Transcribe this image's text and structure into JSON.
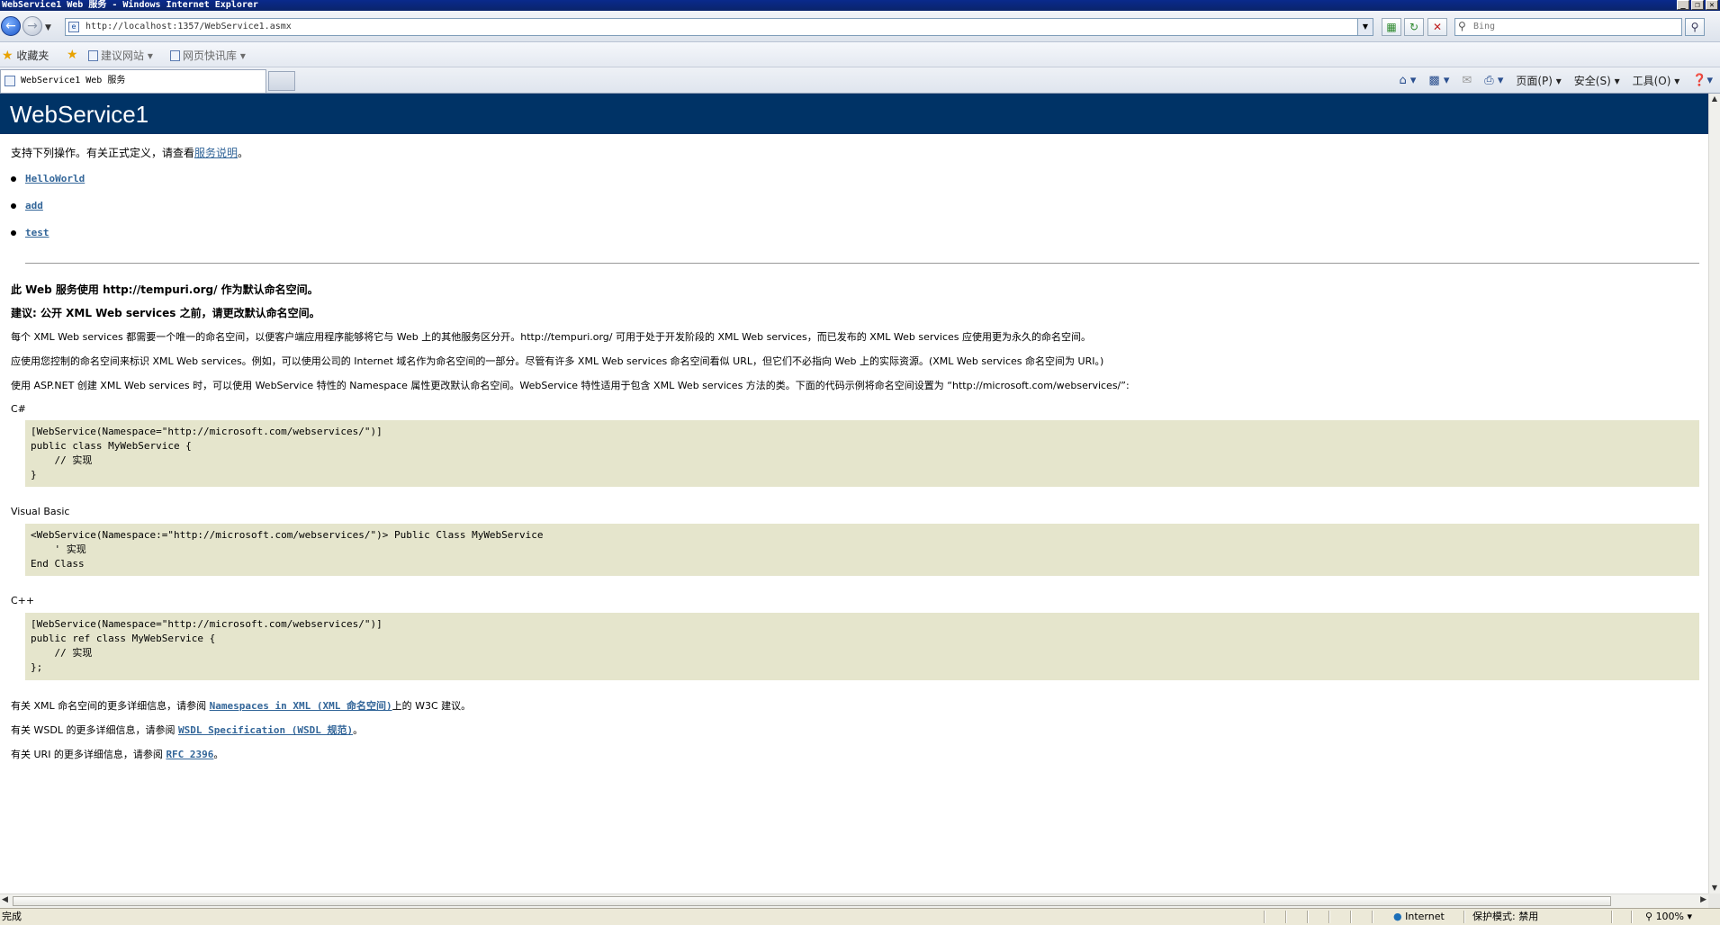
{
  "window": {
    "title": "WebService1 Web 服务 - Windows Internet Explorer",
    "controls": {
      "minimize": "_",
      "restore": "❐",
      "close": "✕"
    }
  },
  "address_bar": {
    "url": "http://localhost:1357/WebService1.asmx",
    "search_placeholder": "Bing"
  },
  "favorites_bar": {
    "favorites_label": "收藏夹",
    "items": [
      "建议网站 ▾",
      "网页快讯库 ▾"
    ]
  },
  "tab": {
    "title": "WebService1 Web 服务"
  },
  "command_bar": {
    "page_menu": "页面(P) ▾",
    "safety_menu": "安全(S) ▾",
    "tools_menu": "工具(O) ▾"
  },
  "page": {
    "heading": "WebService1",
    "intro_text": "支持下列操作。有关正式定义，请查看",
    "intro_link": "服务说明",
    "intro_end": "。",
    "operations": [
      "HelloWorld",
      "add",
      "test"
    ],
    "notice_title": "此 Web 服务使用 http://tempuri.org/ 作为默认命名空间。",
    "recommendation_title": "建议: 公开 XML Web services 之前，请更改默认命名空间。",
    "para1": "每个 XML Web services 都需要一个唯一的命名空间，以便客户端应用程序能够将它与 Web 上的其他服务区分开。http://tempuri.org/ 可用于处于开发阶段的 XML Web services，而已发布的 XML Web services 应使用更为永久的命名空间。",
    "para2": "应使用您控制的命名空间来标识 XML Web services。例如，可以使用公司的 Internet 域名作为命名空间的一部分。尽管有许多 XML Web services 命名空间看似 URL，但它们不必指向 Web 上的实际资源。(XML Web services 命名空间为 URI。)",
    "para3": "使用 ASP.NET 创建 XML Web services 时，可以使用 WebService 特性的 Namespace 属性更改默认命名空间。WebService 特性适用于包含 XML Web services 方法的类。下面的代码示例将命名空间设置为 “http://microsoft.com/webservices/”:",
    "code_samples": [
      {
        "language": "C#",
        "code": "[WebService(Namespace=\"http://microsoft.com/webservices/\")]\npublic class MyWebService {\n    // 实现\n}"
      },
      {
        "language": "Visual Basic",
        "code": "<WebService(Namespace:=\"http://microsoft.com/webservices/\")> Public Class MyWebService\n    ' 实现\nEnd Class"
      },
      {
        "language": "C++",
        "code": "[WebService(Namespace=\"http://microsoft.com/webservices/\")]\npublic ref class MyWebService {\n    // 实现\n};"
      }
    ],
    "more_xml_pre": "有关 XML 命名空间的更多详细信息，请参阅 ",
    "more_xml_link": "Namespaces in XML (XML 命名空间)",
    "more_xml_post": "上的 W3C 建议。",
    "more_wsdl_pre": "有关 WSDL 的更多详细信息，请参阅 ",
    "more_wsdl_link": "WSDL Specification (WSDL 规范)",
    "more_wsdl_post": "。",
    "more_uri_pre": "有关 URI 的更多详细信息，请参阅 ",
    "more_uri_link": "RFC 2396",
    "more_uri_post": "。"
  },
  "status_bar": {
    "status": "完成",
    "zone": "Internet",
    "protected_mode": "保护模式: 禁用",
    "zoom": "100%"
  },
  "colors": {
    "banner": "#003366",
    "code_background": "#e5e5cc",
    "link": "#336699"
  }
}
